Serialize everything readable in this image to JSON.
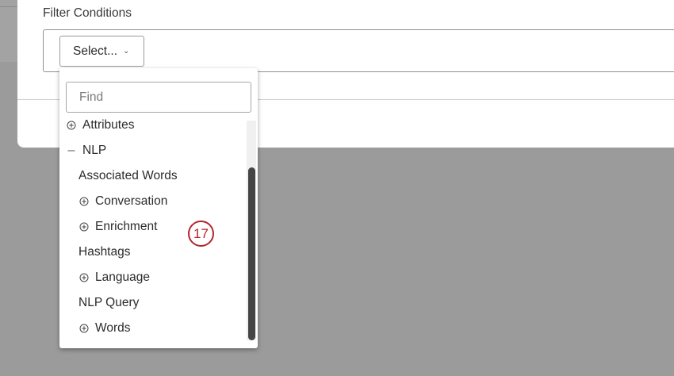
{
  "panel": {
    "title": "Filter Conditions"
  },
  "select": {
    "label": "Select...",
    "chevron_icon": "chevron-down-icon"
  },
  "dropdown": {
    "search_placeholder": "Find",
    "items": [
      {
        "label": "Attributes",
        "icon": "plus-circle-icon"
      },
      {
        "label": "NLP",
        "icon": "minus-icon"
      },
      {
        "label": "Associated Words",
        "icon": ""
      },
      {
        "label": "Conversation",
        "icon": "plus-circle-icon"
      },
      {
        "label": "Enrichment",
        "icon": "plus-circle-icon"
      },
      {
        "label": "Hashtags",
        "icon": ""
      },
      {
        "label": "Language",
        "icon": "plus-circle-icon"
      },
      {
        "label": "NLP Query",
        "icon": ""
      },
      {
        "label": "Words",
        "icon": "plus-circle-icon"
      }
    ]
  },
  "step_badge": {
    "number": "17"
  },
  "colors": {
    "accent": "#b3262d",
    "overlay": "#9b9b9b",
    "scrollbar": "#454545"
  }
}
